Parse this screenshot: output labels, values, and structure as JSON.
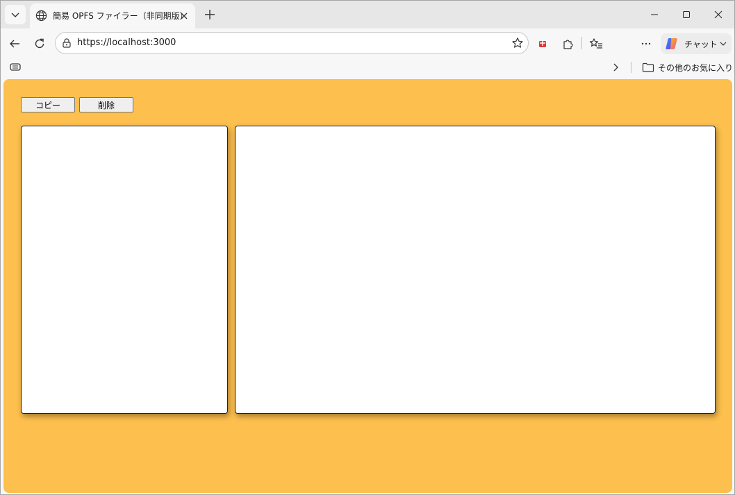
{
  "browser": {
    "tab": {
      "title": "簡易 OPFS ファイラー（非同期版）"
    },
    "address": {
      "url": "https://localhost:3000"
    },
    "copilot": {
      "label": "チャット"
    },
    "bookmarks": {
      "other_label": "その他のお気に入り"
    }
  },
  "app": {
    "background_color": "#fdbf4d",
    "buttons": {
      "copy_label": "コピー",
      "delete_label": "削除"
    }
  }
}
